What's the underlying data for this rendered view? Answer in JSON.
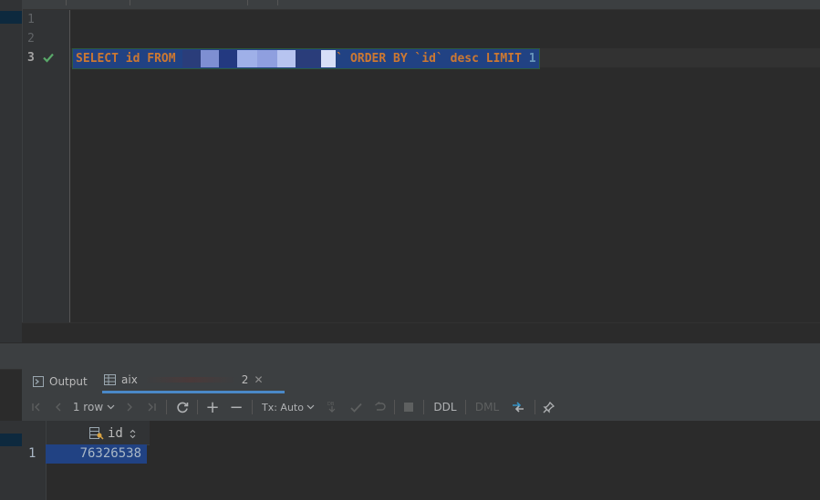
{
  "editor": {
    "line_numbers": [
      "1",
      "2",
      "3"
    ],
    "active_line": "3",
    "query": {
      "select_part": "SELECT id FROM ",
      "after_table": "` ORDER BY `id` desc LIMIT ",
      "limit_value": "1"
    }
  },
  "tool_window": {
    "tabs": [
      {
        "label": "Output",
        "icon": "console-icon"
      },
      {
        "label": "aix",
        "suffix": "2",
        "icon": "table-icon"
      }
    ]
  },
  "toolbar": {
    "row_count": "1 row",
    "tx_mode": "Tx: Auto",
    "ddl_label": "DDL",
    "dml_label": "DML"
  },
  "results": {
    "columns": [
      {
        "name": "id"
      }
    ],
    "rows": [
      {
        "num": "1",
        "id": "76326538"
      }
    ]
  },
  "colors": {
    "keyword": "#cc7832",
    "number": "#6897bb",
    "selection": "#214283",
    "check": "#59a869",
    "accent_tab": "#4a88c7"
  }
}
